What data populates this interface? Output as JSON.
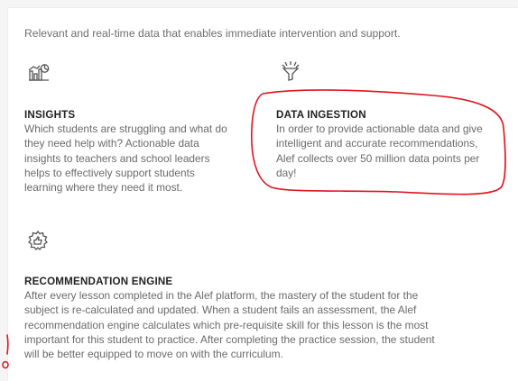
{
  "intro": "Relevant and real-time data that enables immediate intervention and support.",
  "features": [
    {
      "icon": "analytics-icon",
      "title": "INSIGHTS",
      "lines": [
        "Which students are struggling and what do",
        "they need help with? Actionable data",
        "insights to teachers and school leaders",
        "helps to effectively support students",
        "learning where they need it most."
      ]
    },
    {
      "icon": "funnel-icon",
      "title": "DATA INGESTION",
      "lines": [
        "In order to provide actionable data and give",
        "intelligent and accurate recommendations,",
        "Alef collects over 50 million data points per",
        "day!"
      ]
    },
    {
      "icon": "gear-thumbs-up-icon",
      "title": "RECOMMENDATION ENGINE",
      "lines": [
        "After every lesson completed in the Alef platform, the mastery of the student for the",
        "subject is re-calculated and updated. When a student fails an assessment, the Alef",
        "recommendation engine calculates which pre-requisite skill for this lesson is the most",
        "important for this student to practice. After completing the practice session, the student",
        "will be better equipped to move on with the curriculum."
      ]
    }
  ],
  "colors": {
    "annotation": "#e0141e",
    "title": "#222222",
    "body_text": "#6a6a6a"
  }
}
